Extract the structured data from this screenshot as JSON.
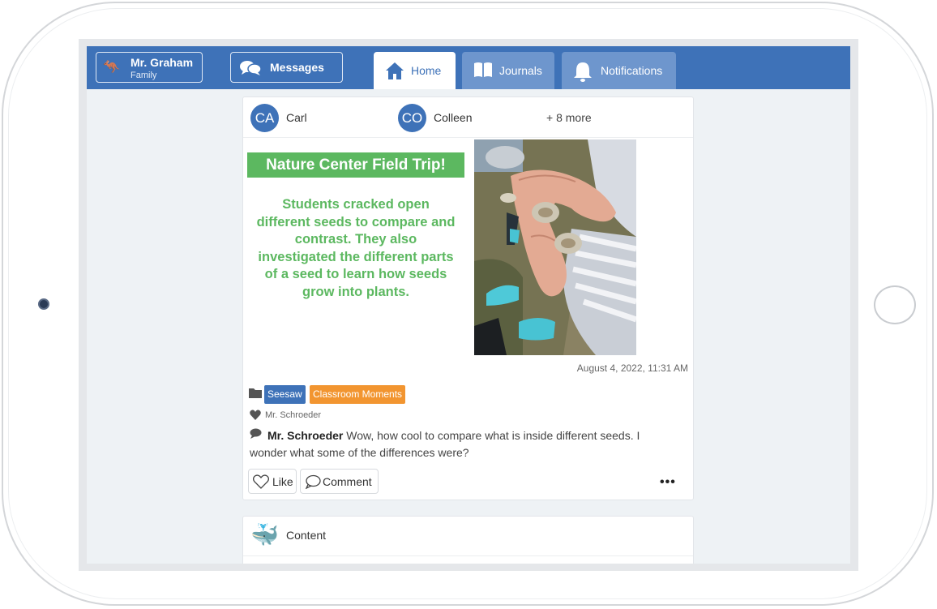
{
  "nav": {
    "profile": {
      "name": "Mr. Graham",
      "role": "Family"
    },
    "messages_label": "Messages",
    "tabs": [
      {
        "label": "Home",
        "active": true
      },
      {
        "label": "Journals",
        "active": false
      },
      {
        "label": "Notifications",
        "active": false
      }
    ]
  },
  "post": {
    "people": [
      {
        "initials": "CA",
        "name": "Carl"
      },
      {
        "initials": "CO",
        "name": "Colleen"
      }
    ],
    "more_people": "+ 8 more",
    "graphic_title": "Nature Center Field Trip!",
    "graphic_text": "Students cracked open different seeds to compare and contrast. They also investigated the different parts of a seed to learn how seeds grow into plants.",
    "timestamp": "August 4, 2022, 11:31 AM",
    "tags": [
      "Seesaw",
      "Classroom Moments"
    ],
    "liked_by": "Mr. Schroeder",
    "comment": {
      "author": "Mr. Schroeder",
      "text": " Wow, how cool to compare what is inside different seeds. I wonder what some of the differences were?"
    },
    "like_label": "Like",
    "comment_label": "Comment"
  },
  "second_post": {
    "label": "Content"
  },
  "colors": {
    "nav_blue": "#3e72b8",
    "inactive_tab": "#6e96cd",
    "green": "#5cb860",
    "orange_tag": "#f29530"
  }
}
